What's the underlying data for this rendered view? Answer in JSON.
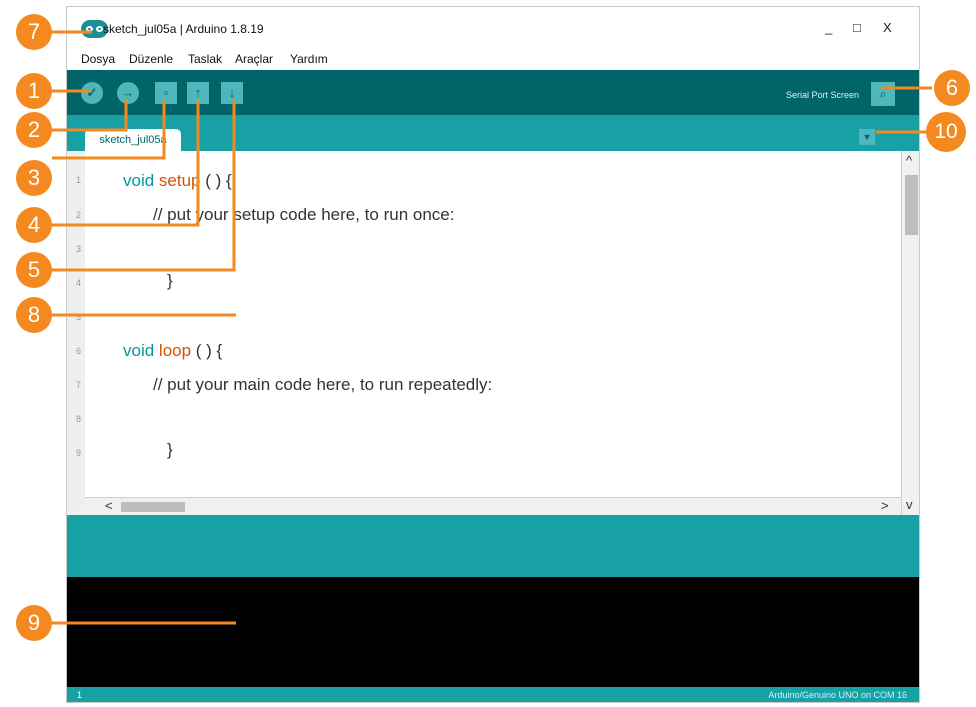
{
  "window": {
    "title": "sketch_jul05a | Arduino 1.8.19",
    "controls": {
      "minimize": "_",
      "maximize": "□",
      "close": "X"
    }
  },
  "menu": [
    "Dosya",
    "Düzenle",
    "Taslak",
    "Araçlar",
    "Yardım"
  ],
  "toolbar": {
    "buttons": [
      {
        "name": "verify",
        "icon": "check-icon",
        "glyph": "✓"
      },
      {
        "name": "upload",
        "icon": "arrow-right-icon",
        "glyph": "→"
      },
      {
        "name": "new",
        "icon": "new-file-icon",
        "glyph": "▫"
      },
      {
        "name": "open",
        "icon": "open-arrow-up-icon",
        "glyph": "↑"
      },
      {
        "name": "save",
        "icon": "save-arrow-down-icon",
        "glyph": "↓"
      }
    ],
    "serial_label": "Serial Port Screen",
    "serial_icon": "magnifier-icon",
    "serial_glyph": "⌕"
  },
  "tabs": {
    "active": "sketch_jul05a",
    "menu_glyph": "▼"
  },
  "editor": {
    "line_numbers": [
      "1",
      "2",
      "3",
      "4",
      "5",
      "6",
      "7",
      "8",
      "9"
    ],
    "code": {
      "line1_kw": "void",
      "line1_fn": "setup",
      "line1_rest": " ( ) {",
      "line2": "// put your setup code here, to run once:",
      "line4": "}",
      "line6_kw": "void",
      "line6_fn": "loop",
      "line6_rest": " ( ) {",
      "line7": "// put your main code here, to run repeatedly:",
      "line9": "}"
    },
    "scroll_glyphs": {
      "up": "^",
      "down": "v",
      "left": "<",
      "right": ">"
    }
  },
  "statusbar": {
    "line": "1",
    "board": "Arduino/Genuino UNO on COM 16"
  },
  "callouts": [
    "1",
    "2",
    "3",
    "4",
    "5",
    "6",
    "7",
    "8",
    "9",
    "10"
  ],
  "colors": {
    "toolbar": "#006468",
    "tabs": "#17a1a5",
    "button": "#4db7bb",
    "callout": "#f4891f"
  }
}
